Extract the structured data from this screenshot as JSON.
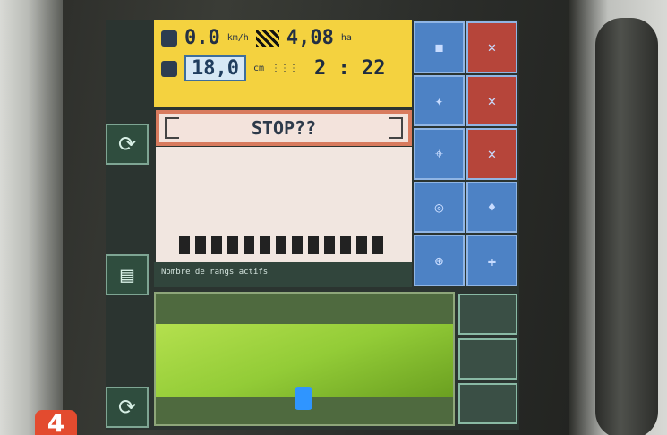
{
  "top_panel": {
    "speed_value": "0.0",
    "speed_unit": "km/h",
    "rate_value": "4,08",
    "rate_unit": "ha",
    "seeds_value": "18,0",
    "seeds_unit": "cm",
    "time_value": "2 : 22"
  },
  "alert": {
    "text": "STOP??"
  },
  "footer": {
    "status": "Nombre de rangs actifs"
  },
  "label": {
    "number": "4"
  },
  "colors": {
    "panel_yellow": "#f4d23f",
    "alert_border": "#d87b5e",
    "map_green": "#93cc37",
    "tile_blue": "#4d82c5",
    "label_red": "#e34b2f"
  }
}
